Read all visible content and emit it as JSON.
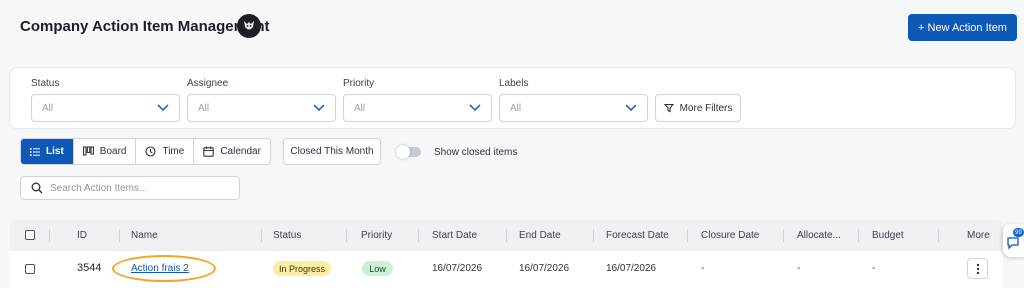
{
  "header": {
    "title": "Company Action Item Management",
    "new_button_label": "+ New Action Item"
  },
  "filters": [
    {
      "label": "Status",
      "value": "All"
    },
    {
      "label": "Assignee",
      "value": "All"
    },
    {
      "label": "Priority",
      "value": "All"
    },
    {
      "label": "Labels",
      "value": "All"
    }
  ],
  "more_filters_label": "More Filters",
  "view_tabs": [
    {
      "label": "List",
      "icon": "list-icon",
      "active": true
    },
    {
      "label": "Board",
      "icon": "board-icon",
      "active": false
    },
    {
      "label": "Time",
      "icon": "clock-icon",
      "active": false
    },
    {
      "label": "Calendar",
      "icon": "calendar-icon",
      "active": false
    }
  ],
  "closed_this_month_label": "Closed This Month",
  "show_closed": {
    "label": "Show closed items",
    "on": false
  },
  "search": {
    "placeholder": "Search Action Items..."
  },
  "table": {
    "columns": [
      "ID",
      "Name",
      "Status",
      "Priority",
      "Start Date",
      "End Date",
      "Forecast Date",
      "Closure Date",
      "Allocate...",
      "Budget",
      "More"
    ],
    "rows": [
      {
        "id": "3544",
        "name": "Action frais 2",
        "status": "In Progress",
        "priority": "Low",
        "start_date": "16/07/2026",
        "end_date": "16/07/2026",
        "forecast_date": "16/07/2026",
        "closure_date": "-",
        "allocated": "-",
        "budget": "-"
      }
    ]
  },
  "chat_badge": "99",
  "colors": {
    "primary": "#0e58b8",
    "status_in_progress": "#fbeea4",
    "priority_low": "#cdeed7",
    "highlight_ring": "#f2a51f"
  }
}
